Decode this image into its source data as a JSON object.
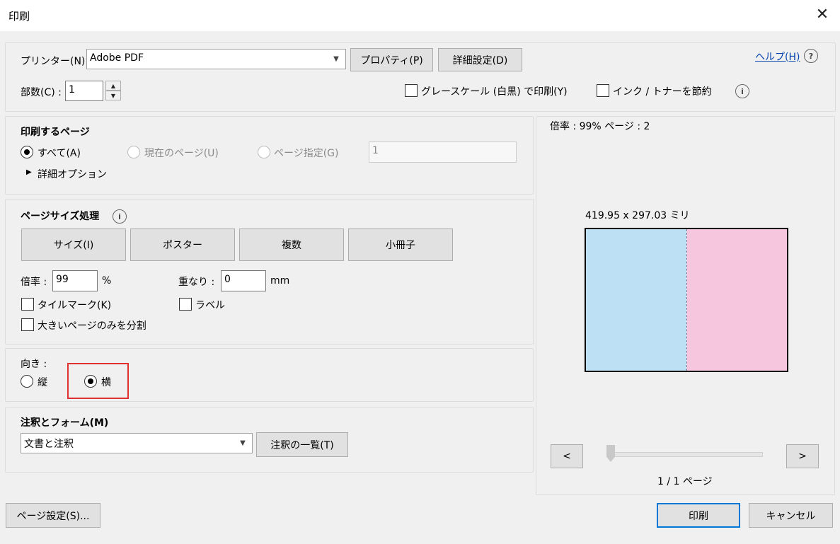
{
  "window": {
    "title": "印刷"
  },
  "printer": {
    "label": "プリンター(N) :",
    "value": "Adobe PDF",
    "properties_button": "プロパティ(P)",
    "advanced_button": "詳細設定(D)",
    "help_link": "ヘルプ(H)"
  },
  "copies": {
    "label": "部数(C) :",
    "value": "1"
  },
  "options": {
    "grayscale_label": "グレースケール (白黒) で印刷(Y)",
    "save_ink_label": "インク / トナーを節約"
  },
  "pages_to_print": {
    "heading": "印刷するページ",
    "all_label": "すべて(A)",
    "current_label": "現在のページ(U)",
    "range_label": "ページ指定(G)",
    "range_value": "1",
    "more_options_label": "詳細オプション"
  },
  "page_sizing": {
    "heading": "ページサイズ処理",
    "buttons": [
      "サイズ(I)",
      "ポスター",
      "複数",
      "小冊子"
    ],
    "scale_label": "倍率 :",
    "scale_value": "99",
    "scale_unit": "%",
    "overlap_label": "重なり :",
    "overlap_value": "0",
    "overlap_unit": "mm",
    "tile_marks_label": "タイルマーク(K)",
    "labels_label": "ラベル",
    "large_pages_label": "大きいページのみを分割"
  },
  "orientation": {
    "heading": "向き :",
    "portrait_label": "縦",
    "landscape_label": "横"
  },
  "comments_forms": {
    "heading": "注釈とフォーム(M)",
    "select_value": "文書と注釈",
    "summarize_button": "注釈の一覧(T)"
  },
  "preview": {
    "scale_text": "倍率 : 99% ページ : 2",
    "dimensions_text": "419.95 x 297.03 ミリ",
    "prev_button": "<",
    "next_button": ">",
    "page_counter": "1 / 1 ページ",
    "colors": {
      "left_half": "#bde0f5",
      "right_half": "#f5c6de"
    }
  },
  "footer": {
    "page_setup_button": "ページ設定(S)...",
    "print_button": "印刷",
    "cancel_button": "キャンセル"
  },
  "highlight": {
    "color": "#e03030"
  }
}
